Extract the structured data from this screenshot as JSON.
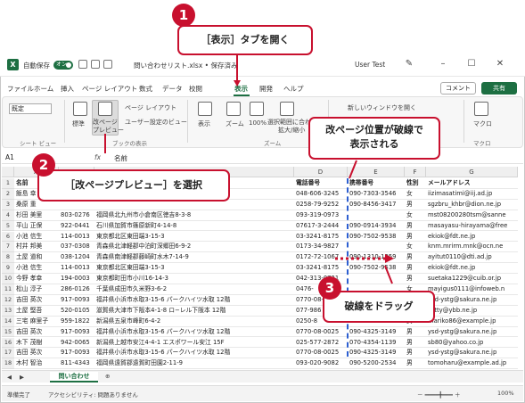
{
  "callouts": {
    "c1_num": "1",
    "c1_text": "［表示］タブを開く",
    "c2_num": "2",
    "c2_text": "［改ページプレビュー］を選択",
    "c3_num": "3",
    "c3_text": "破線をドラッグ",
    "c_note": "改ページ位置が破線で\n表示される"
  },
  "titlebar": {
    "autosave": "自動保存",
    "toggle": "オン",
    "filename": "問い合わせリスト.xlsx • 保存済み",
    "user": "User Test"
  },
  "menu": {
    "tabs": [
      "ファイル",
      "ホーム",
      "挿入",
      "ページ レイアウト",
      "数式",
      "データ",
      "校閲",
      "表示",
      "開発",
      "ヘルプ"
    ],
    "comment": "コメント",
    "share": "共有"
  },
  "ribbon": {
    "select_value": "既定",
    "normal": "標準",
    "pagebreak_line1": "改ページ",
    "pagebreak_line2": "プレビュー",
    "page_layout": "ページ レイアウト",
    "custom_view": "ユーザー設定のビュー",
    "show": "表示",
    "zoom": "ズーム",
    "zoom100": "100%",
    "zoom_sel_line1": "選択範囲に合わせて",
    "zoom_sel_line2": "拡大/縮小",
    "new_window": "新しいウィンドウを開く",
    "macro": "マクロ",
    "group_sheet": "シート ビュー",
    "group_book": "ブックの表示",
    "group_zoom": "ズーム",
    "group_macro": "マクロ"
  },
  "formula": {
    "namebox": "A1",
    "fx": "fx",
    "value": "名前"
  },
  "columns": [
    "A",
    "B",
    "C",
    "D",
    "E",
    "F",
    "G"
  ],
  "header_row": [
    "名前",
    "",
    "",
    "電話番号",
    "携帯番号",
    "性別",
    "メールアドレス"
  ],
  "rows": [
    [
      "飯島 幸",
      "",
      "",
      "048-606-3245",
      "090-7303-3546",
      "女",
      "iizimasatimi@iij.ad.jp"
    ],
    [
      "桑原 重",
      "",
      "",
      "0258-79-9252",
      "090-8456-3417",
      "男",
      "sgzbru_khbr@dion.ne.jp"
    ],
    [
      "杉田 美里",
      "803-0276",
      "福岡県北九州市小倉南区徳吉8-3-8",
      "093-319-0973",
      "",
      "女",
      "mst08200280tsm@sanne"
    ],
    [
      "平山 正保",
      "922-0441",
      "石川県加賀市篠原新町4-14-8",
      "07617-3-2444",
      "090-0914-3934",
      "男",
      "masayasu-hirayama@free"
    ],
    [
      "小池 信生",
      "114-0013",
      "東京都北区東田端3-15-3",
      "03-3241-8175",
      "090-7502-9538",
      "男",
      "ekiok@fdt.ne.jp"
    ],
    [
      "村井 邦美",
      "037-0308",
      "青森県北津軽郡中泊町深郷田6-9-2",
      "0173-34-9827",
      "",
      "女",
      "knm.mrirm.mnk@ocn.ne"
    ],
    [
      "土屋 道和",
      "038-1204",
      "青森県南津軽郡藤崎町水木7-14-9",
      "0172-72-1067",
      "090-1310-1959",
      "男",
      "ayitut0110@dti.ad.jp"
    ],
    [
      "小池 信生",
      "114-0013",
      "東京都北区東田端3-15-3",
      "03-3241-8175",
      "090-7502-9538",
      "男",
      "ekiok@fdt.ne.jp"
    ],
    [
      "今野 孝幸",
      "194-0003",
      "東京都町田市小川16-14-3",
      "042-313-0721",
      "",
      "男",
      "suetaka1229@cuib.or.jp"
    ],
    [
      "松山 淳子",
      "286-0126",
      "千葉県成田市久米野3-6-2",
      "0476-",
      "",
      "女",
      "mayigus0111@infoweb.n"
    ],
    [
      "吉田 英次",
      "917-0093",
      "福井県小浜市水取3-15-6 パークハイツ水取 12階",
      "0770-08-0",
      "",
      "男",
      "ysd-ystg@sakura.ne.jp"
    ],
    [
      "土屋 堅吾",
      "520-0105",
      "滋賀県大津市下阪本4-1-8 ロ−レル下阪本 12階",
      "077-986",
      "",
      "男",
      "k_tty@ybb.ne.jp"
    ],
    [
      "三宅 麻里子",
      "959-1822",
      "新潟県五泉市峰町6-4-2",
      "0250-8",
      "",
      "女",
      "mariko86@example.jp"
    ],
    [
      "吉田 英次",
      "917-0093",
      "福井県小浜市水取3-15-6 パークハイツ水取 12階",
      "0770-08-0025",
      "090-4325-3149",
      "男",
      "ysd-ystg@sakura.ne.jp"
    ],
    [
      "木下 茂樹",
      "942-0065",
      "新潟県上越市安江4-4-1 エスポワール安江 15F",
      "025-577-2872",
      "070-4354-1139",
      "男",
      "sb80@yahoo.co.jp"
    ],
    [
      "吉田 英次",
      "917-0093",
      "福井県小浜市水取3-15-6 パークハイツ水取 12階",
      "0770-08-0025",
      "090-4325-3149",
      "男",
      "ysd-ystg@sakura.ne.jp"
    ],
    [
      "木村 智治",
      "811-4343",
      "福岡県遠賀郡遠賀町田園2-11-9",
      "093-020-9082",
      "090-5200-2534",
      "男",
      "tomoharu@example.ad.jp"
    ]
  ],
  "sheet_tab": "問い合わせ",
  "status": {
    "ready": "準備完了",
    "access": "アクセシビリティ: 問題ありません",
    "zoom": "100%"
  }
}
